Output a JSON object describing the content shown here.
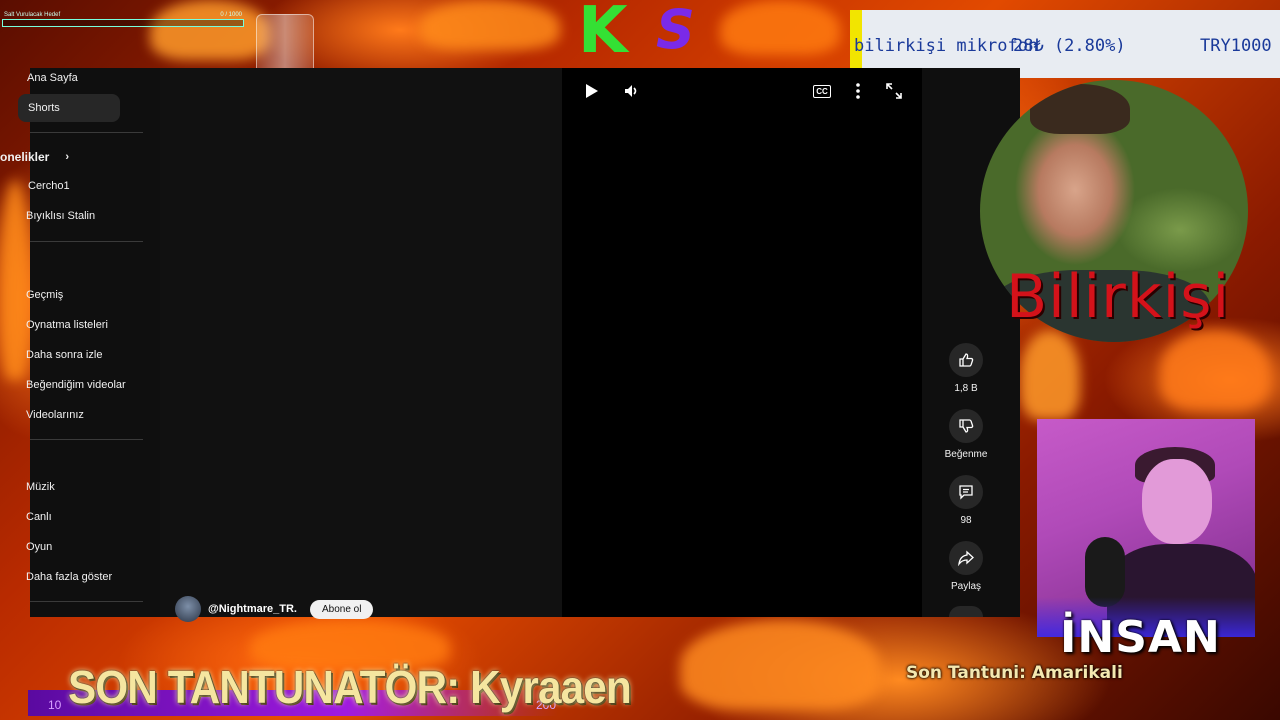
{
  "top_progress": {
    "label": "Salt Vurulacak Hedef",
    "count": "0 / 1000",
    "fraction": 0.0
  },
  "ks_logo": {
    "k": "K",
    "s": "S"
  },
  "ticker": {
    "item": "bilirkişi mikrofon",
    "amount": "28₺ (2.80%)",
    "goal": "TRY1000"
  },
  "sidebar": {
    "items": [
      {
        "label": "Ana Sayfa"
      },
      {
        "label": "Shorts",
        "active": true
      },
      {
        "label": "Abonelikler",
        "section": true
      },
      {
        "label": "Cercho1"
      },
      {
        "label": "Bıyıklısı Stalin"
      },
      {
        "label": "Geçmiş"
      },
      {
        "label": "Oynatma listeleri"
      },
      {
        "label": "Daha sonra izle"
      },
      {
        "label": "Beğendiğim videolar"
      },
      {
        "label": "Videolarınız"
      },
      {
        "label": "Müzik"
      },
      {
        "label": "Canlı"
      },
      {
        "label": "Oyun"
      },
      {
        "label": "Daha fazla göster"
      }
    ]
  },
  "player": {
    "cc": "CC"
  },
  "channel": {
    "name": "@Nightmare_TR.",
    "subscribe": "Abone ol"
  },
  "actions": {
    "like": "1,8 B",
    "dislike": "Beğenme",
    "comments": "98",
    "share": "Paylaş"
  },
  "cams": {
    "cam1_name": "Bilirkişi",
    "cam2_name": "İNSAN"
  },
  "bottom": {
    "son_tantunator": "SON TANTUNATÖR: Kyraaen",
    "son_tantuni": "Son Tantuni: Amarikali",
    "strip_left": "10",
    "strip_right": "200"
  },
  "colors": {
    "youtube_bg": "#0f0f0f",
    "ticker_bar": "#f2e500",
    "k_green": "#34e034",
    "s_purple": "#7a2ae8",
    "cam1_name": "#d4121a"
  }
}
